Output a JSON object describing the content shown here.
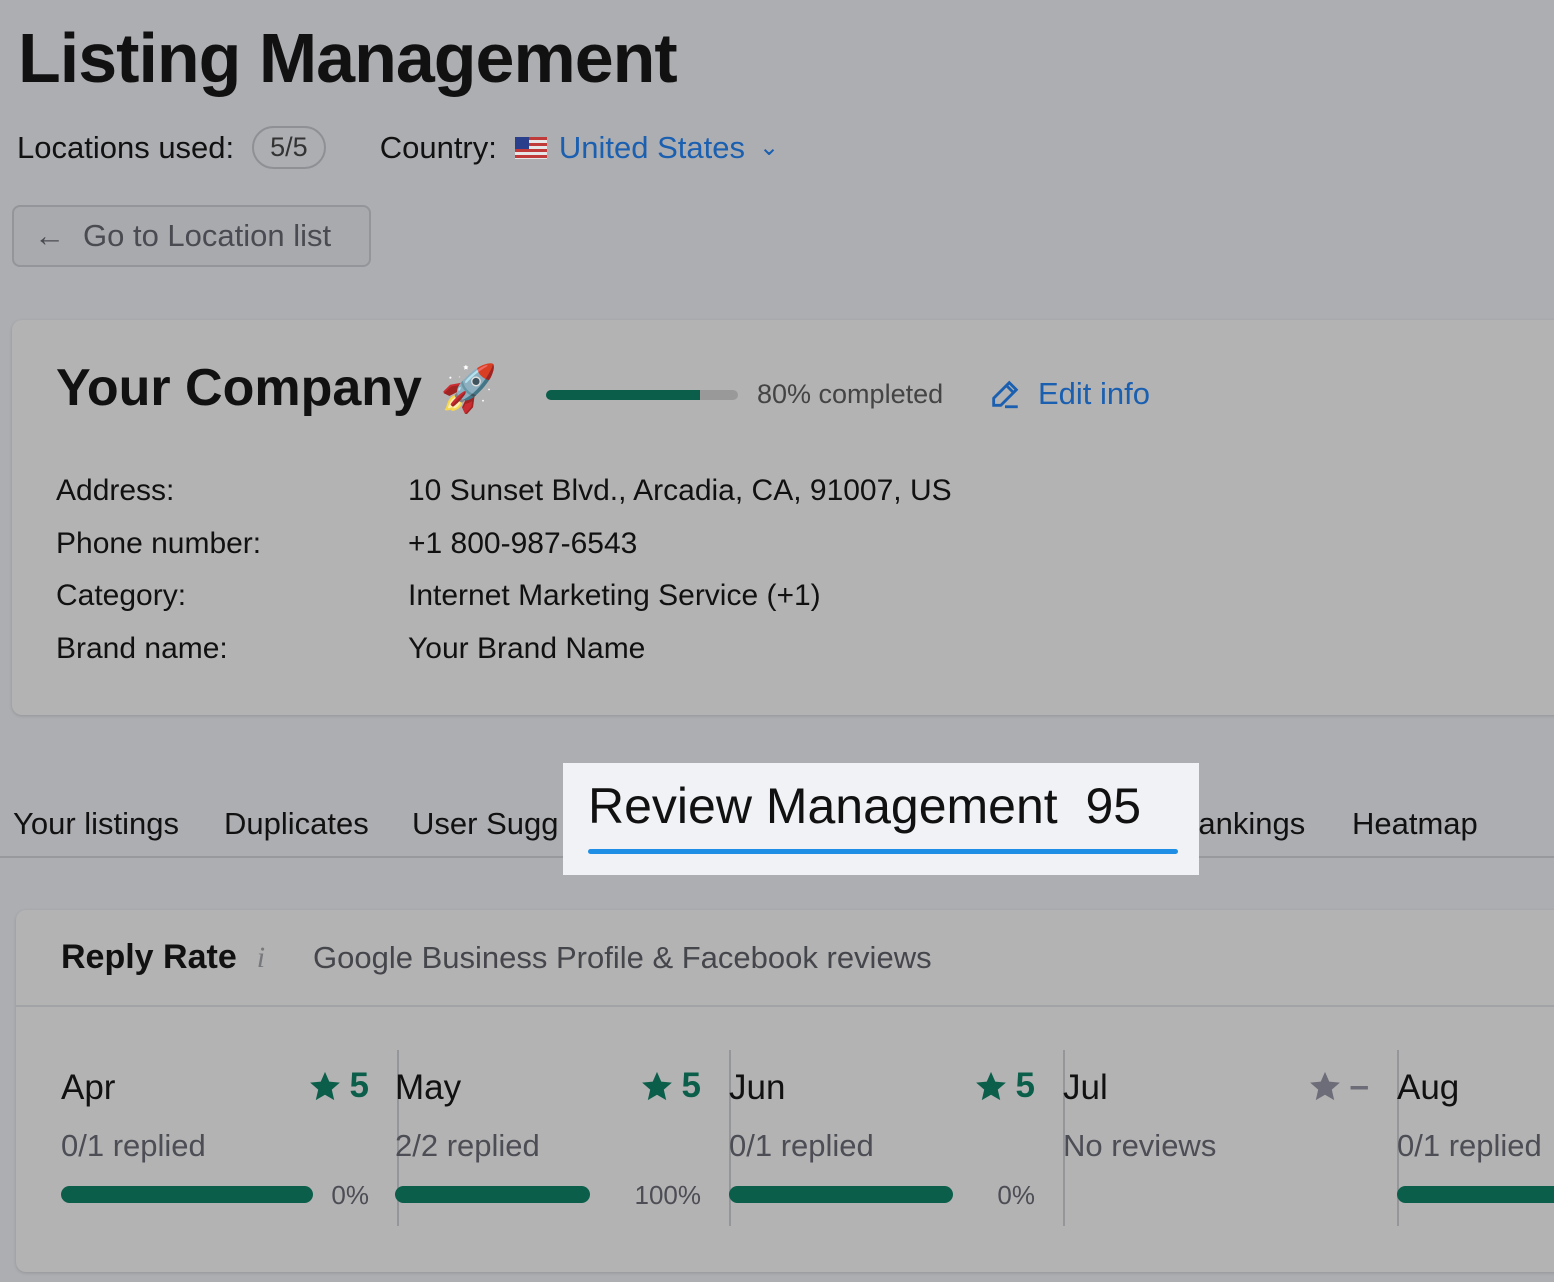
{
  "header": {
    "title": "Listing Management",
    "locations_label": "Locations used:",
    "locations_value": "5/5",
    "country_label": "Country:",
    "country_value": "United States",
    "back_button": "Go to Location list"
  },
  "company": {
    "name": "Your Company",
    "emoji": "🚀",
    "progress_percent": 80,
    "progress_text": "80% completed",
    "edit_label": "Edit info",
    "fields": [
      {
        "label": "Address:",
        "value": "10 Sunset Blvd., Arcadia, CA, 91007, US"
      },
      {
        "label": "Phone number:",
        "value": "+1 800-987-6543"
      },
      {
        "label": "Category:",
        "value": "Internet Marketing Service (+1)"
      },
      {
        "label": "Brand name:",
        "value": "Your Brand Name"
      }
    ]
  },
  "tabs": [
    {
      "label": "Your listings"
    },
    {
      "label": "Duplicates"
    },
    {
      "label": "User Sugg"
    },
    {
      "label": "Review Management  95",
      "active": true
    },
    {
      "label": "Rankings"
    },
    {
      "label": "Heatmap"
    }
  ],
  "reply_rate": {
    "title": "Reply Rate",
    "info_icon": "i",
    "subtitle": "Google Business Profile & Facebook reviews",
    "months": [
      {
        "name": "Apr",
        "rating": "5",
        "replied": "0/1 replied",
        "percent": "0%"
      },
      {
        "name": "May",
        "rating": "5",
        "replied": "2/2 replied",
        "percent": "100%"
      },
      {
        "name": "Jun",
        "rating": "5",
        "replied": "0/1 replied",
        "percent": "0%"
      },
      {
        "name": "Jul",
        "rating": "–",
        "replied": "No reviews",
        "percent": ""
      },
      {
        "name": "Aug",
        "rating": "",
        "replied": "0/1 replied",
        "percent": ""
      }
    ]
  },
  "colors": {
    "accent_blue": "#1a5fb0",
    "progress_green": "#0b5e4a",
    "tab_underline": "#1f8fe6"
  }
}
